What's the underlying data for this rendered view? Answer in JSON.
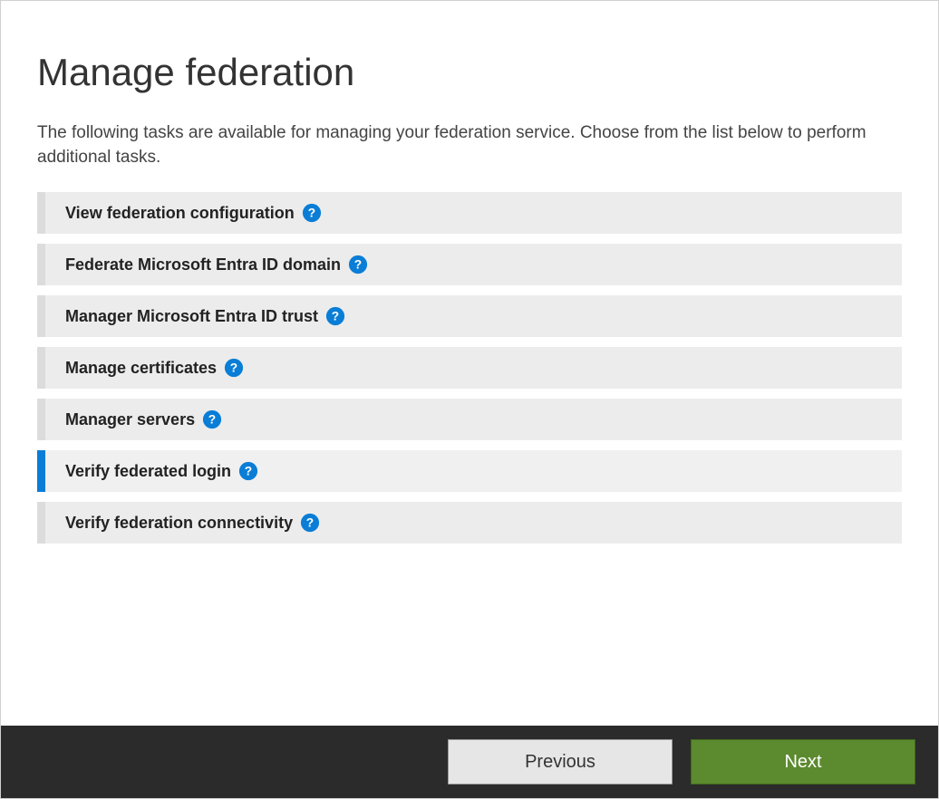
{
  "page": {
    "title": "Manage federation",
    "description": "The following tasks are available for managing your federation service.  Choose from the list below to perform additional tasks."
  },
  "tasks": [
    {
      "label": "View federation configuration",
      "selected": false
    },
    {
      "label": "Federate Microsoft Entra ID domain",
      "selected": false
    },
    {
      "label": "Manager Microsoft Entra ID trust",
      "selected": false
    },
    {
      "label": "Manage certificates",
      "selected": false
    },
    {
      "label": "Manager servers",
      "selected": false
    },
    {
      "label": "Verify federated login",
      "selected": true
    },
    {
      "label": "Verify federation connectivity",
      "selected": false
    }
  ],
  "footer": {
    "previous_label": "Previous",
    "next_label": "Next"
  },
  "colors": {
    "accent": "#0a7dd6",
    "next_button": "#5c8a2f"
  }
}
